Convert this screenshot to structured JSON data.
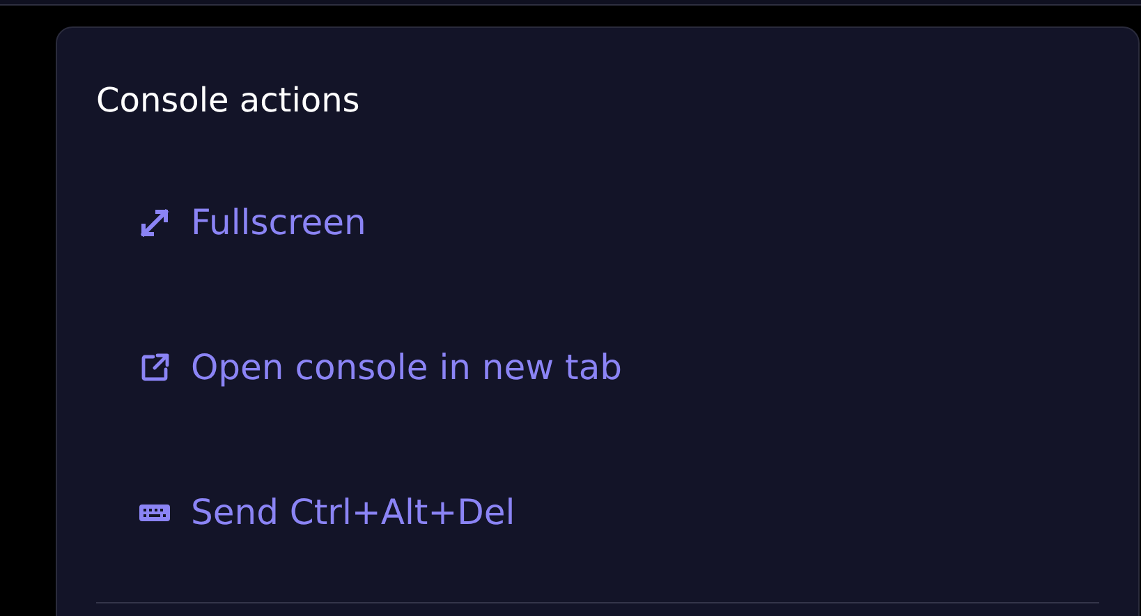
{
  "panel": {
    "title": "Console actions",
    "actions": [
      {
        "kind": "expand",
        "label": "Fullscreen"
      },
      {
        "kind": "external",
        "label": "Open console in new tab"
      },
      {
        "kind": "keyboard",
        "label": "Send Ctrl+Alt+Del"
      }
    ]
  }
}
